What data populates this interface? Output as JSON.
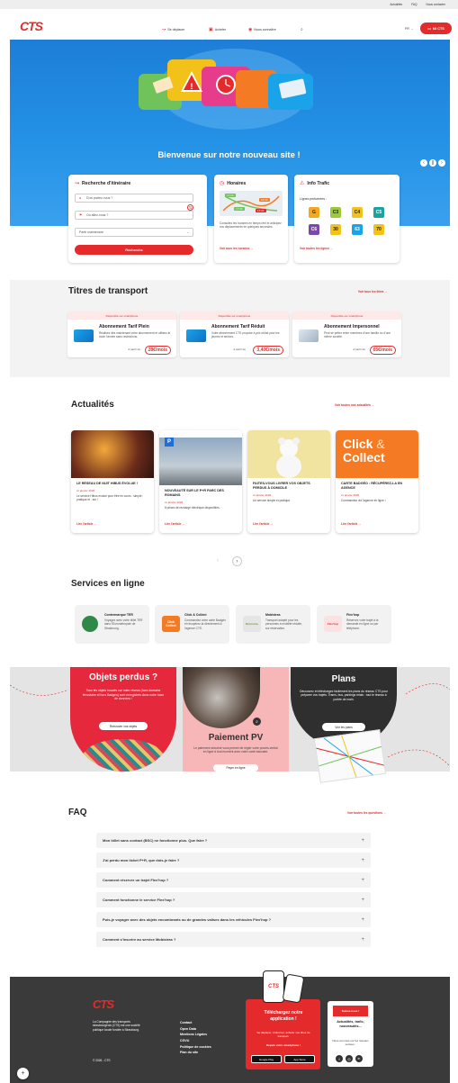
{
  "topbar": {
    "links": [
      "Actualités",
      "FAQ",
      "Nous contacter"
    ]
  },
  "header": {
    "logo": "CTS",
    "nav": [
      "Se déplacer",
      "Acheter",
      "Nous connaître"
    ],
    "lang": "FR",
    "account": "Mt CTS"
  },
  "hero": {
    "title": "Bienvenue sur notre nouveau site !"
  },
  "itinerary": {
    "title": "Recherche d'itinéraire",
    "from_placeholder": "D'où partez-vous ?",
    "to_placeholder": "Où allez-vous ?",
    "when": "Partir maintenant",
    "submit": "Recherche"
  },
  "horaires": {
    "title": "Horaires",
    "text": "Consultez les horaires en temps réel et anticipez vos déplacements en quelques secondes.",
    "link": "Voir tous les horaires →",
    "times": [
      "17:24",
      "16:59",
      "17:36",
      "17:31"
    ]
  },
  "trafic": {
    "title": "Info Trafic",
    "subtitle": "Lignes perturbées :",
    "lines": [
      "G",
      "C3",
      "C4",
      "C5",
      "C6",
      "30",
      "63",
      "70"
    ],
    "link": "Voir toutes les lignes →"
  },
  "tickets": {
    "title": "Titres de transport",
    "see_all": "Voir tous les titres →",
    "items": [
      {
        "badge": "Disponible sur smartphone",
        "name": "Abonnement Tarif Plein",
        "desc": "Réalisez dès maintenant votre abonnement et utilisez-le toute l'année sans restrictions.",
        "from": "à partir de",
        "price": "28€/mois"
      },
      {
        "badge": "Disponible sur smartphone",
        "name": "Abonnement Tarif Réduit",
        "desc": "Votre abonnement CTS propose à prix réduit pour les jeunes et seniors.",
        "from": "à partir de",
        "price": "3,40€/mois"
      },
      {
        "badge": "Disponible sur smartphone",
        "name": "Abonnement Impersonnel",
        "desc": "Peut se prêter entre membres d'une famille ou d'une même société.",
        "from": "à partir de",
        "price": "65€/mois"
      }
    ]
  },
  "news": {
    "title": "Actualités",
    "see_all": "Voir toutes nos actualités →",
    "items": [
      {
        "title": "Le réseau de nuit Hibus évolue !",
        "date": "xx janvier 2026",
        "text": "Le service Hibus évolue pour être en cours : simple : pratique et : sûr !",
        "link": "Lire l'article →"
      },
      {
        "title": "Nouveauté sur le P+R Parc des Romains",
        "date": "xx janvier 2026",
        "text": "8 prises de recharge électrique disponibles.",
        "link": "Lire l'article →"
      },
      {
        "title": "Faites-vous livrer vos objets perdus à domicile",
        "date": "xx janvier 2026",
        "text": "Un service simple et pratique.",
        "link": "Lire l'article →"
      },
      {
        "title": "Carte Badgéo : récupérez-la en agence",
        "date": "xx janvier 2026",
        "text": "Commandez via l'agence en ligne !",
        "link": "Lire l'article →"
      }
    ],
    "promo": [
      "Click",
      "&",
      "Collect"
    ]
  },
  "services": {
    "title": "Services en ligne",
    "items": [
      {
        "name": "Contremarque TER",
        "desc": "Voyagez avec votre billet TER dans l'Eurométropole de Strasbourg."
      },
      {
        "name": "Click & Collect",
        "desc": "Commandez votre carte Badgéo et récupérez-la directement à l'agence CTS."
      },
      {
        "name": "Mobistras",
        "desc": "Transport adapté pour les personnes à mobilité réduite, sur réservation."
      },
      {
        "name": "Flex'hop",
        "desc": "Réservez votre trajet à la demande en ligne ou par téléphone."
      }
    ],
    "icon_labels": [
      "Click Collect",
      "Mobistras",
      "Flex'hop"
    ]
  },
  "promo_band": {
    "lost": {
      "title": "Objets perdus ?",
      "text": "Tous les objets trouvés sur notre réseau (hors domaine ferroviaire et hors Badgéo) sont enregistrés dans notre base de données !",
      "button": "Retrouver vos objets"
    },
    "pv": {
      "title": "Paiement PV",
      "text": "Le paiement sécurisé vous permet de régler votre procès-verbal en ligne à tout moment avec votre carte bancaire.",
      "button": "Payer en ligne"
    },
    "plans": {
      "title": "Plans",
      "text": "Découvrez et téléchargez facilement les plans du réseau CTS pour préparer vos trajets. Trams, bus, parkings relais : tout le réseau à portée de main.",
      "button": "Voir les plans"
    }
  },
  "faq": {
    "title": "FAQ",
    "see_all": "Voir toutes les questions →",
    "items": [
      "Mon billet sans contact (BSC) ne fonctionne plus. Que faire ?",
      "J'ai perdu mon ticket P+R, que dois-je faire ?",
      "Comment réserver un trajet Flex'hop ?",
      "Comment fonctionne le service Flex'hop ?",
      "Puis-je voyager avec des objets encombrants ou de grandes valises dans les véhicules Flex'hop ?",
      "Comment s'inscrire au service Mobistras ?"
    ]
  },
  "footer": {
    "logo": "CTS",
    "about": "La Compagnie des transports strasbourgeois (CTS) est une société publique locale fondée à Strasbourg.",
    "copyright": "© 2026 - CTS",
    "links": [
      "Contact",
      "Open Data",
      "Mentions Légales",
      "CGVU",
      "Politique de cookies",
      "Plan du site"
    ],
    "app_title": "Téléchargez notre application !",
    "app_text": "Se déplacer, s'informer, acheter vos titres de transport.",
    "app_text2": "Depuis votre smartphone !",
    "google": "Google Play",
    "apple": "App Store",
    "social_title": "Actualités, trafic, nouveautés...",
    "social_text": "Nous sommes sur les réseaux sociaux :",
    "social_box": "Suivez-nous !"
  },
  "colors": {
    "brand": "#e42a2a",
    "hero": "#1d7ed7",
    "dark": "#3a3a3a"
  }
}
